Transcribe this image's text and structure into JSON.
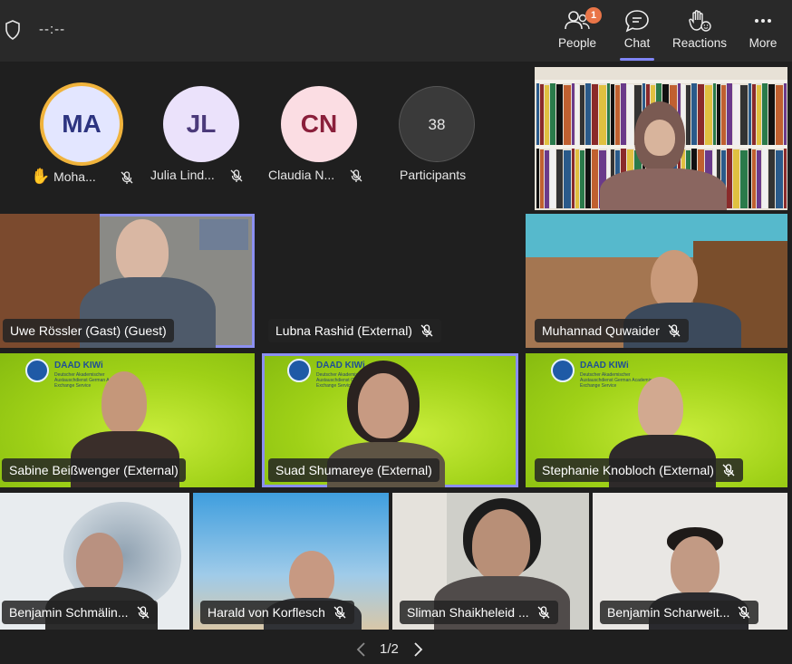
{
  "topbar": {
    "timer": "--:--",
    "people_label": "People",
    "people_badge": "1",
    "chat_label": "Chat",
    "reactions_label": "Reactions",
    "more_label": "More"
  },
  "top_row": {
    "avatars": [
      {
        "initials": "MA",
        "name": "Moha...",
        "bg": "#e3e6ff",
        "fg": "#2d3480",
        "ring": "#f0b33c",
        "raised_hand": true
      },
      {
        "initials": "JL",
        "name": "Julia Lind...",
        "bg": "#ebe2fb",
        "fg": "#4b3a7a",
        "raised_hand": false
      },
      {
        "initials": "CN",
        "name": "Claudia N...",
        "bg": "#fbdde3",
        "fg": "#8a1f3b",
        "raised_hand": false
      }
    ],
    "participants_count": "38",
    "participants_label": "Participants"
  },
  "tiles": [
    {
      "name": "Uwe Rössler (Gast) (Guest)",
      "muted": false,
      "active": true
    },
    {
      "name": "Lubna Rashid (External)",
      "muted": true,
      "active": false
    },
    {
      "name": "Muhannad Quwaider",
      "muted": true,
      "active": false
    },
    {
      "name": "Sabine Beißwenger (External)",
      "muted": false,
      "active": false
    },
    {
      "name": "Suad Shumareye (External)",
      "muted": false,
      "active": true
    },
    {
      "name": "Stephanie Knobloch (External)",
      "muted": true,
      "active": false
    },
    {
      "name": "Benjamin Schmälin...",
      "muted": true,
      "active": false
    },
    {
      "name": "Harald von Korflesch",
      "muted": true,
      "active": false
    },
    {
      "name": "Sliman Shaikheleid ...",
      "muted": true,
      "active": false
    },
    {
      "name": "Benjamin Scharweit...",
      "muted": true,
      "active": false
    }
  ],
  "daad": {
    "title": "DAAD KIWi",
    "subtitle": "Deutscher Akademischer Austauschdienst German Academic Exchange Service"
  },
  "pager": {
    "text": "1/2"
  },
  "colors": {
    "accent": "#7f85f5",
    "badge": "#e97548",
    "active_outline": "#8b8ff0"
  }
}
